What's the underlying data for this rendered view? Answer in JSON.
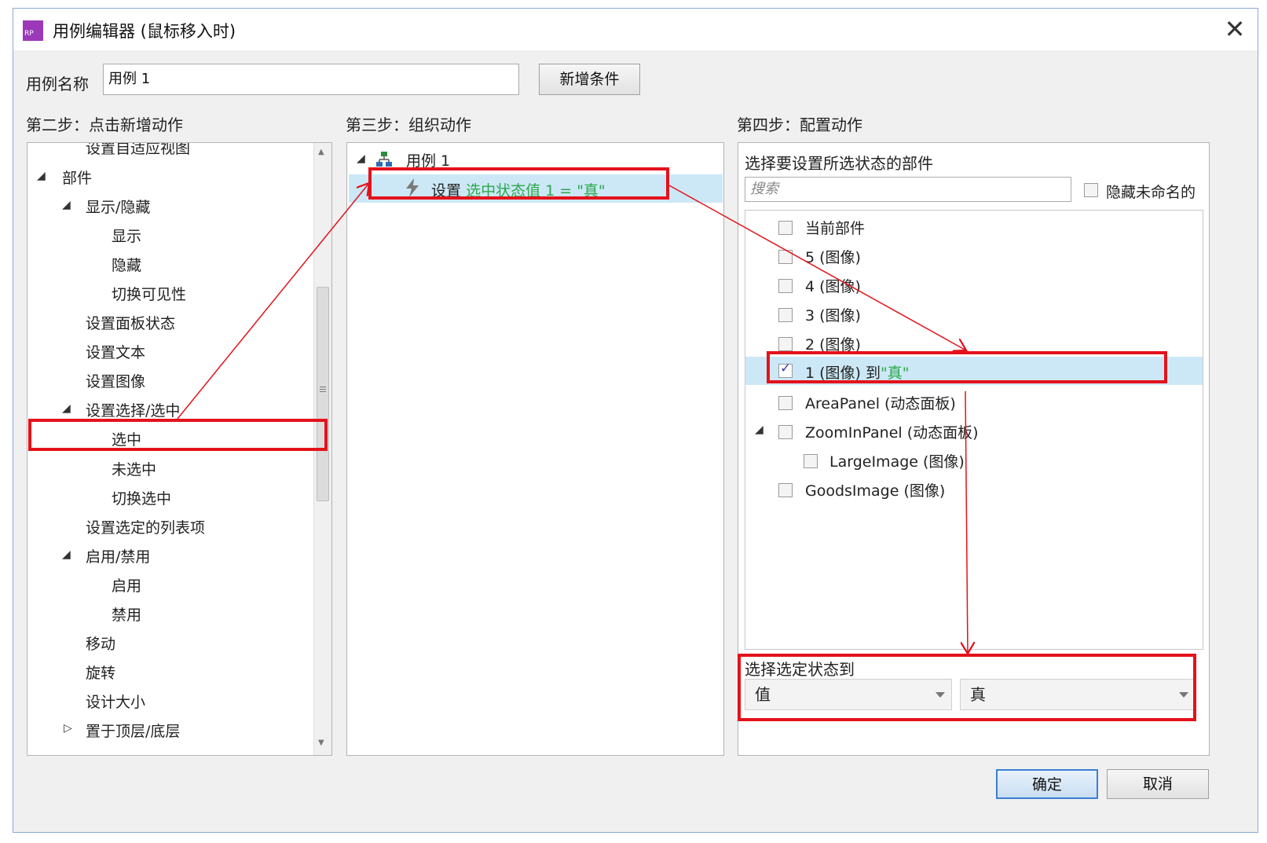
{
  "window": {
    "title": "用例编辑器 (鼠标移入时)",
    "app_icon_text": "RP",
    "close_glyph": "✕"
  },
  "case_name": {
    "label": "用例名称",
    "value": "用例 1",
    "add_condition_button": "新增条件"
  },
  "step2": {
    "heading": "第二步：点击新增动作",
    "items": [
      {
        "label": "设置自适应视图",
        "level": 1
      },
      {
        "label": "部件",
        "level": 0,
        "expanded": true
      },
      {
        "label": "显示/隐藏",
        "level": 1,
        "expanded": true
      },
      {
        "label": "显示",
        "level": 2
      },
      {
        "label": "隐藏",
        "level": 2
      },
      {
        "label": "切换可见性",
        "level": 2
      },
      {
        "label": "设置面板状态",
        "level": 1
      },
      {
        "label": "设置文本",
        "level": 1
      },
      {
        "label": "设置图像",
        "level": 1
      },
      {
        "label": "设置选择/选中",
        "level": 1,
        "expanded": true
      },
      {
        "label": "选中",
        "level": 2,
        "highlighted": true
      },
      {
        "label": "未选中",
        "level": 2
      },
      {
        "label": "切换选中",
        "level": 2
      },
      {
        "label": "设置选定的列表项",
        "level": 1
      },
      {
        "label": "启用/禁用",
        "level": 1,
        "expanded": true
      },
      {
        "label": "启用",
        "level": 2
      },
      {
        "label": "禁用",
        "level": 2
      },
      {
        "label": "移动",
        "level": 1
      },
      {
        "label": "旋转",
        "level": 1
      },
      {
        "label": "设计大小",
        "level": 1
      },
      {
        "label": "置于顶层/底层",
        "level": 1,
        "expanded": false
      }
    ]
  },
  "step3": {
    "heading": "第三步：组织动作",
    "case_label": "用例 1",
    "action_prefix": "设置",
    "action_detail": "选中状态值 1 = \"真\""
  },
  "step4": {
    "heading": "第四步：配置动作",
    "subheading": "选择要设置所选状态的部件",
    "search_placeholder": "搜索",
    "hide_unnamed_label": "隐藏未命名的",
    "widgets": [
      {
        "label": "当前部件",
        "checked": false,
        "indent": 0
      },
      {
        "label": "5 (图像)",
        "checked": false,
        "indent": 0
      },
      {
        "label": "4 (图像)",
        "checked": false,
        "indent": 0
      },
      {
        "label": "3 (图像)",
        "checked": false,
        "indent": 0
      },
      {
        "label": "2 (图像)",
        "checked": false,
        "indent": 0
      },
      {
        "label": "1 (图像) 到",
        "suffix": "\"真\"",
        "checked": true,
        "indent": 0,
        "selected": true
      },
      {
        "label": "AreaPanel (动态面板)",
        "checked": false,
        "indent": 0
      },
      {
        "label": "ZoomInPanel (动态面板)",
        "checked": false,
        "indent": 0,
        "expanded": true
      },
      {
        "label": "LargeImage (图像)",
        "checked": false,
        "indent": 1
      },
      {
        "label": "GoodsImage (图像)",
        "checked": false,
        "indent": 0
      }
    ],
    "state_label": "选择选定状态到",
    "state_type": "值",
    "state_value": "真"
  },
  "footer": {
    "ok": "确定",
    "cancel": "取消"
  },
  "colors": {
    "highlight_red": "#e4121b",
    "selection_blue": "#cce8f6",
    "accent_green": "#2ba84a",
    "icon_purple": "#9b39b8"
  }
}
